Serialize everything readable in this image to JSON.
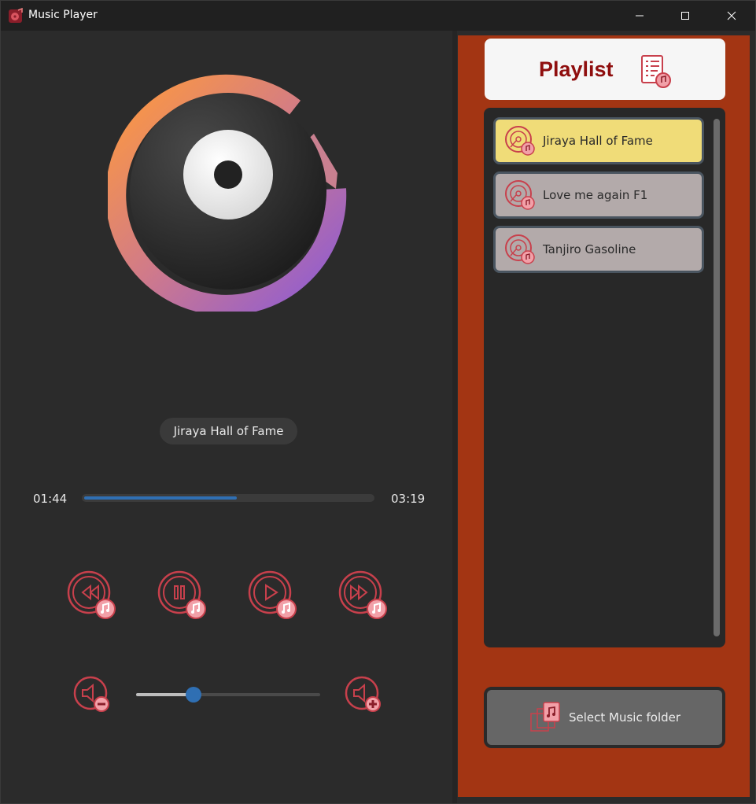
{
  "window": {
    "title": "Music Player"
  },
  "player": {
    "current_song": "Jiraya Hall of Fame",
    "elapsed": "01:44",
    "duration": "03:19",
    "progress_fraction": 0.53,
    "volume_fraction": 0.31
  },
  "controls": {
    "rewind_icon": "rewind-music-icon",
    "pause_icon": "pause-music-icon",
    "play_icon": "play-music-icon",
    "forward_icon": "fast-forward-music-icon",
    "volume_down_icon": "volume-down-icon",
    "volume_up_icon": "volume-up-icon"
  },
  "playlist": {
    "title": "Playlist",
    "items": [
      {
        "label": "Jiraya Hall of Fame",
        "active": true
      },
      {
        "label": "Love me again F1",
        "active": false
      },
      {
        "label": "Tanjiro Gasoline",
        "active": false
      }
    ]
  },
  "folder_button": {
    "label": "Select Music folder"
  },
  "colors": {
    "accent_red": "#c8404c",
    "panel_orange": "#a33513",
    "active_item": "#f0dc78",
    "progress_blue": "#2f6fb3"
  }
}
